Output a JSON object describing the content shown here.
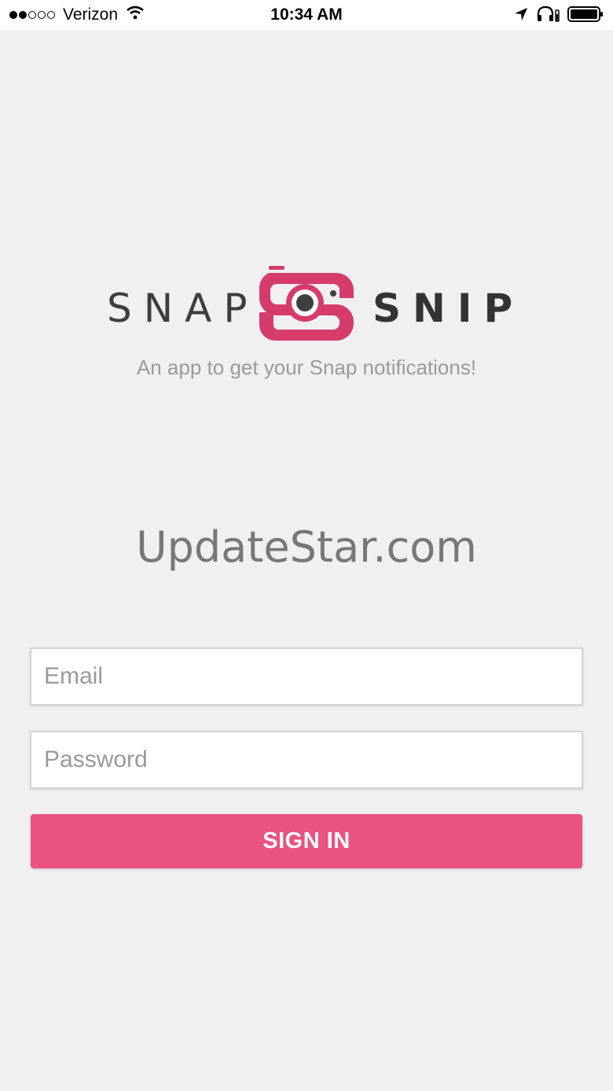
{
  "status_bar": {
    "carrier": "Verizon",
    "time": "10:34 AM",
    "signal_bars": 2,
    "signal_total": 5
  },
  "logo": {
    "word_left": "SNAP",
    "word_right": "SNIP",
    "brand_color": "#d63c6b"
  },
  "tagline": "An app to get your Snap notifications!",
  "watermark": "UpdateStar.com",
  "login": {
    "email_placeholder": "Email",
    "password_placeholder": "Password",
    "signin_label": "SIGN IN",
    "button_color": "#ea5282"
  }
}
